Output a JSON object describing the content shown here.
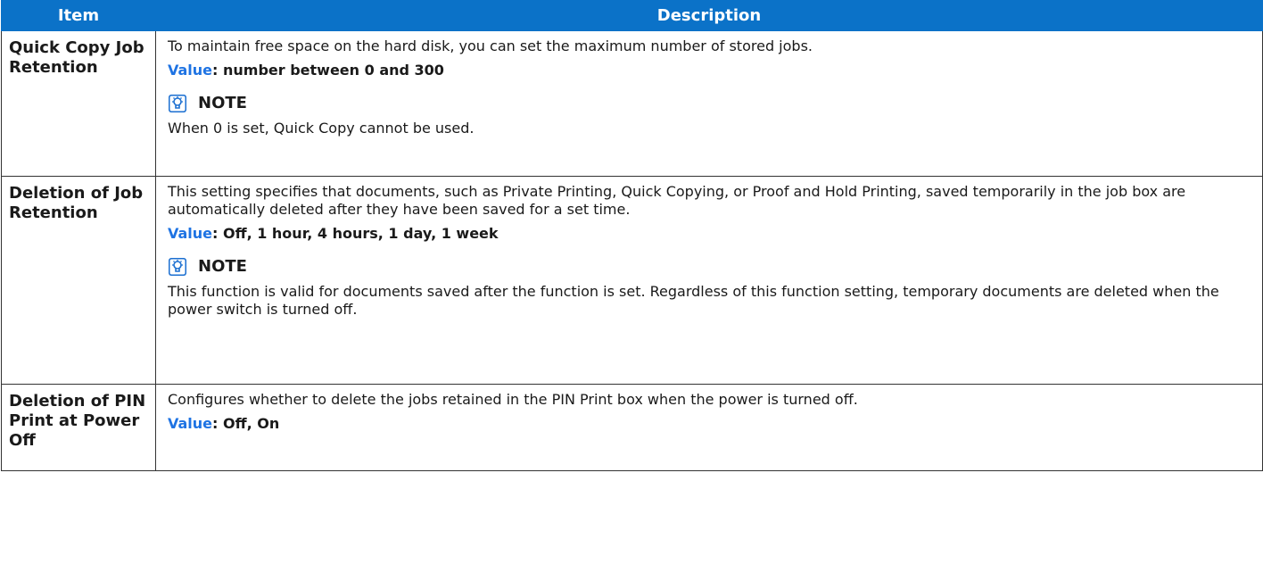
{
  "header": {
    "item": "Item",
    "description": "Description"
  },
  "value_label": "Value",
  "note_title": "NOTE",
  "rows": [
    {
      "item": "Quick Copy Job Retention",
      "description": "To maintain free space on the hard disk, you can set the maximum number of stored jobs.",
      "value": ": number between 0 and 300",
      "note": "When 0 is set, Quick Copy cannot be used."
    },
    {
      "item": "Deletion of Job Retention",
      "description": "This setting specifies that documents, such as Private Printing, Quick Copying, or Proof and Hold Printing, saved temporarily in the job box are automatically deleted after they have been saved for a set time.",
      "value": ": Off, 1 hour, 4 hours, 1 day, 1 week",
      "note": "This function is valid for documents saved after the function is set. Regardless of this function setting, temporary documents are deleted when the power switch is turned off."
    },
    {
      "item": "Deletion of PIN Print at Power Off",
      "description": "Configures whether to delete the jobs retained in the PIN Print box when the power is turned off.",
      "value": ": Off, On"
    }
  ],
  "icon": "note-lightbulb-icon",
  "colors": {
    "header_bg": "#0b72c8",
    "value_label": "#1e73e3",
    "icon_blue": "#1b6fd1"
  }
}
